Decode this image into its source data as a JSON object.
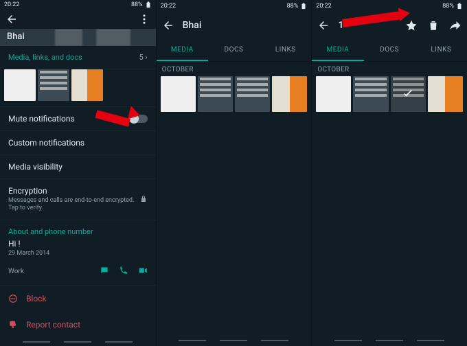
{
  "status": {
    "time": "20:22",
    "battery": "88%"
  },
  "panel1": {
    "title": "Bhai",
    "section_media": {
      "header": "Media, links, and docs",
      "count": "5 ›"
    },
    "mute": "Mute notifications",
    "custom": "Custom notifications",
    "visibility": "Media visibility",
    "encryption": {
      "title": "Encryption",
      "sub": "Messages and calls are end-to-end encrypted. Tap to verify."
    },
    "about_hdr": "About and phone number",
    "about_text": "Hi !",
    "about_date": "29 March 2014",
    "work": "Work",
    "block": "Block",
    "report": "Report contact"
  },
  "panel2": {
    "title": "Bhai",
    "tabs": {
      "media": "MEDIA",
      "docs": "DOCS",
      "links": "LINKS"
    },
    "month": "OCTOBER"
  },
  "panel3": {
    "count": "1",
    "tabs": {
      "media": "MEDIA",
      "docs": "DOCS",
      "links": "LINKS"
    },
    "month": "OCTOBER"
  }
}
